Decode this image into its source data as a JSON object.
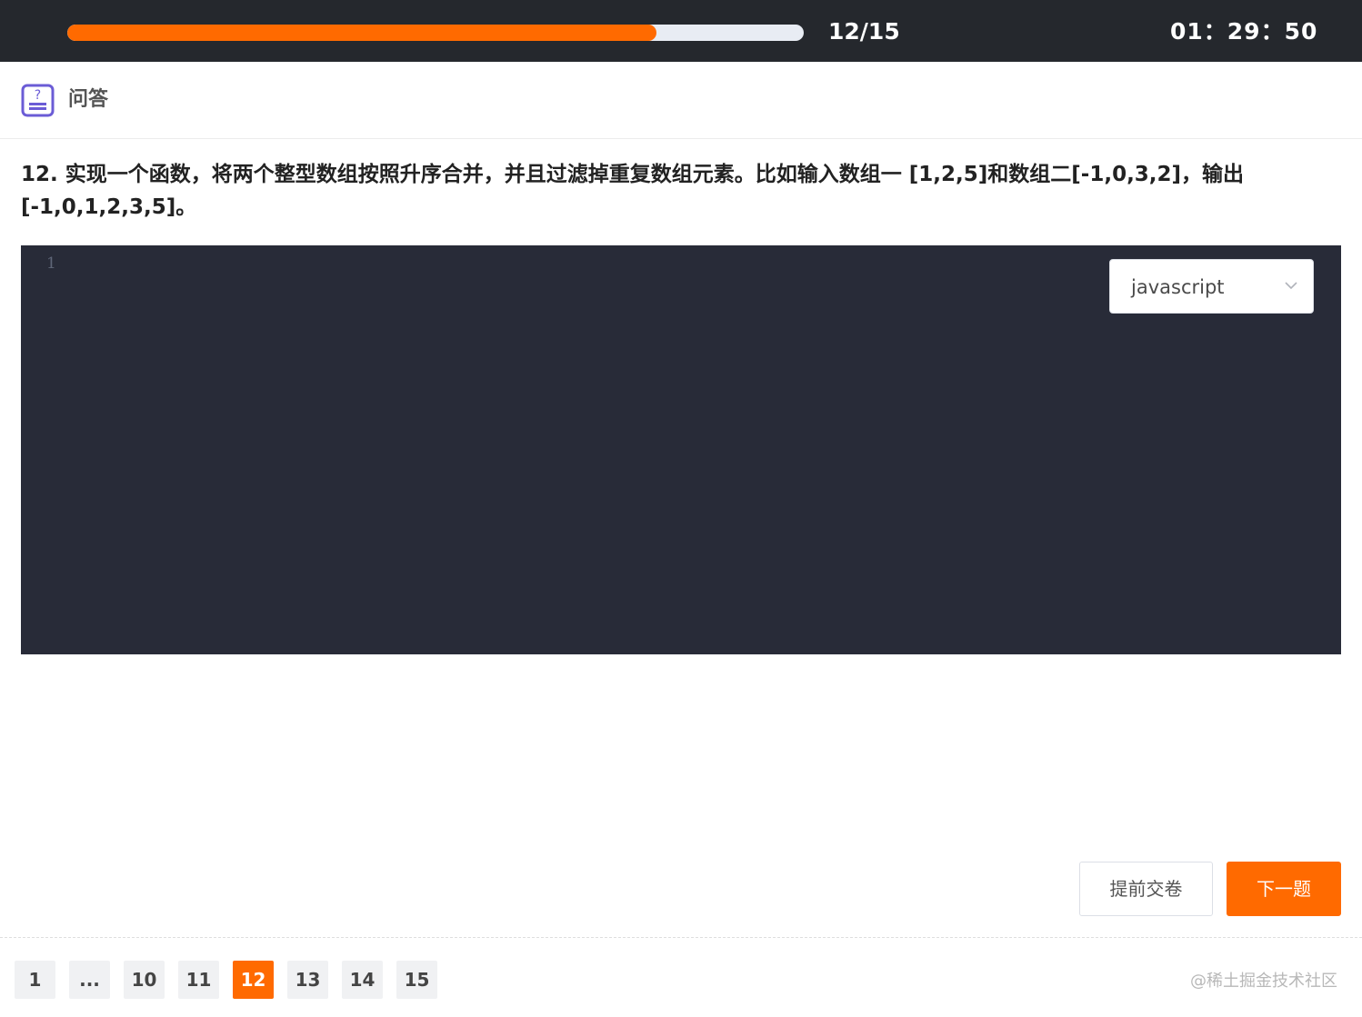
{
  "progress": {
    "fraction": 0.8,
    "count_text": "12/15"
  },
  "timer": "01：29：50",
  "section": {
    "icon": "question-icon",
    "label": "问答"
  },
  "question": {
    "text": "12. 实现一个函数，将两个整型数组按照升序合并，并且过滤掉重复数组元素。比如输入数组一 [1,2,5]和数组二[-1,0,3,2]，输出[-1,0,1,2,3,5]。"
  },
  "editor": {
    "line_numbers": [
      "1"
    ],
    "language": "javascript",
    "dropdown_icon": "chevron-down-icon"
  },
  "actions": {
    "submit_label": "提前交卷",
    "next_label": "下一题"
  },
  "pagination": {
    "pages": [
      "1",
      "...",
      "10",
      "11",
      "12",
      "13",
      "14",
      "15"
    ],
    "active": "12"
  },
  "watermark": "@稀土掘金技术社区",
  "colors": {
    "accent": "#ff6a00",
    "topbar": "#25282d",
    "editor_bg": "#282b38",
    "icon_purple": "#6b5cd6"
  }
}
